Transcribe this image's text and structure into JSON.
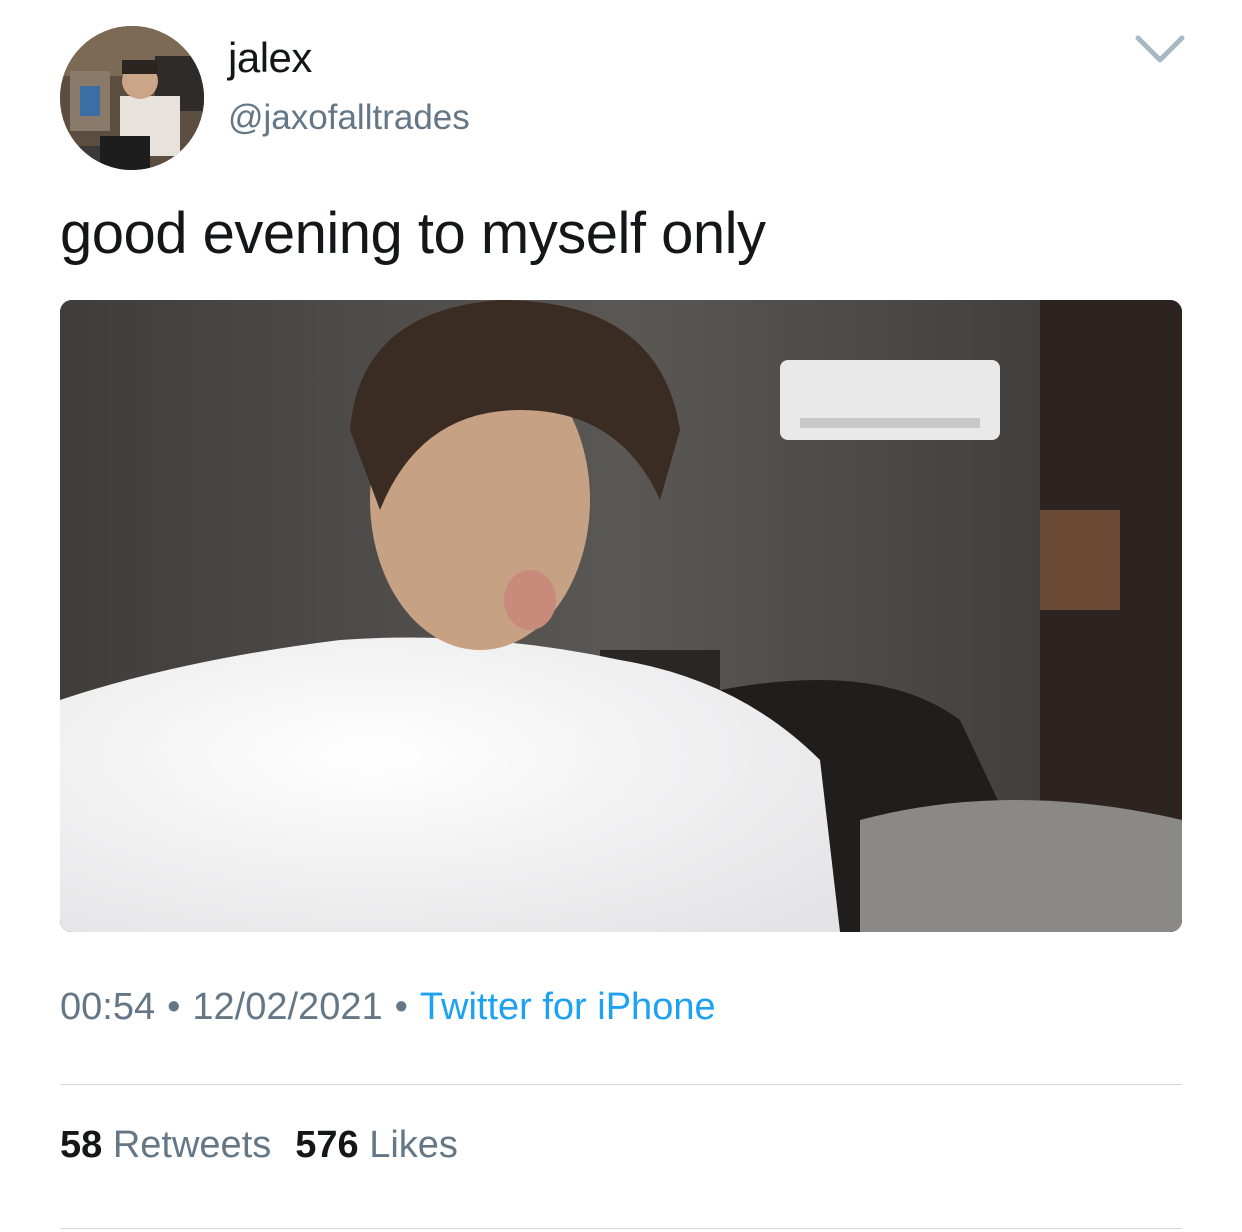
{
  "user": {
    "display_name": "jalex",
    "handle": "@jaxofalltrades",
    "avatar_icon": "profile-photo"
  },
  "header": {
    "menu_icon": "chevron-down-icon"
  },
  "tweet": {
    "text": "good evening to myself only",
    "media_icon": "photo"
  },
  "meta": {
    "time": "00:54",
    "separator": "•",
    "date": "12/02/2021",
    "source": "Twitter for iPhone"
  },
  "stats": {
    "retweets_count": "58",
    "retweets_label": "Retweets",
    "likes_count": "576",
    "likes_label": "Likes"
  },
  "colors": {
    "text": "#14171a",
    "secondary": "#657786",
    "link": "#1da1f2",
    "divider": "#ccd6dd"
  }
}
